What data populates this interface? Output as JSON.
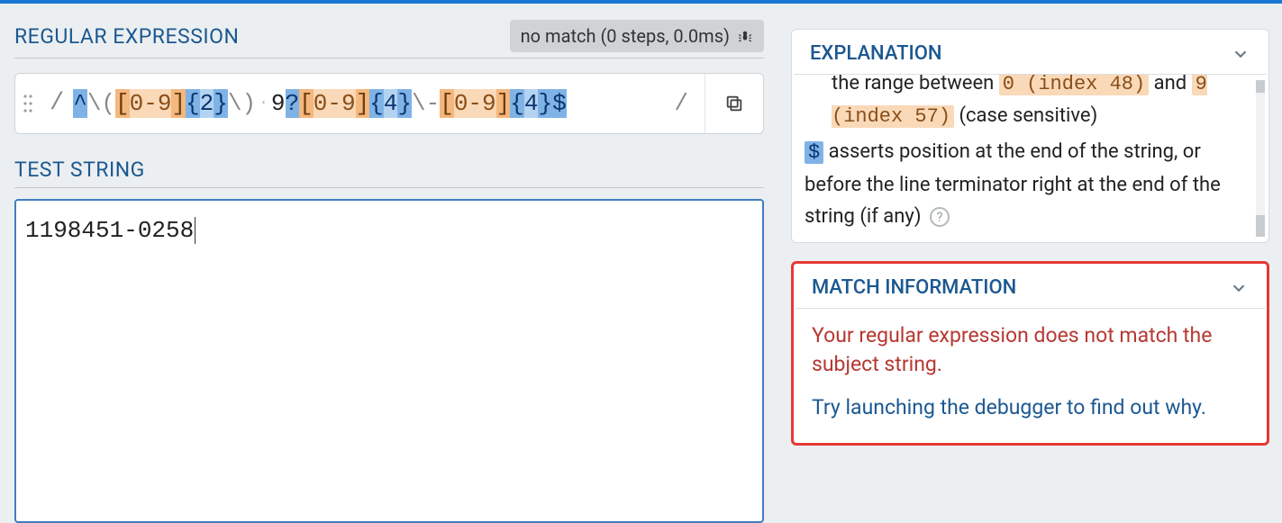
{
  "left": {
    "regex_title": "REGULAR EXPRESSION",
    "status": "no match (0 steps, 0.0ms)",
    "delim_open": "/",
    "delim_close": "/",
    "regex_tokens": [
      {
        "t": "^",
        "c": "tok-anchor"
      },
      {
        "t": "\\(",
        "c": "tok-escape"
      },
      {
        "t": "[",
        "c": "tok-class-bracket"
      },
      {
        "t": "0-9",
        "c": "tok-class-range"
      },
      {
        "t": "]",
        "c": "tok-class-bracket"
      },
      {
        "t": "{",
        "c": "tok-quant-brace"
      },
      {
        "t": "2",
        "c": "tok-quant-num"
      },
      {
        "t": "}",
        "c": "tok-quant-brace"
      },
      {
        "t": "\\)",
        "c": "tok-escape"
      },
      {
        "t": "·",
        "c": "tok-dot"
      },
      {
        "t": "9",
        "c": "tok-literal"
      },
      {
        "t": "?",
        "c": "tok-quant-q"
      },
      {
        "t": "[",
        "c": "tok-class-bracket"
      },
      {
        "t": "0-9",
        "c": "tok-class-range"
      },
      {
        "t": "]",
        "c": "tok-class-bracket"
      },
      {
        "t": "{",
        "c": "tok-quant-brace"
      },
      {
        "t": "4",
        "c": "tok-quant-num"
      },
      {
        "t": "}",
        "c": "tok-quant-brace"
      },
      {
        "t": "\\-",
        "c": "tok-escape"
      },
      {
        "t": "[",
        "c": "tok-class-bracket"
      },
      {
        "t": "0-9",
        "c": "tok-class-range"
      },
      {
        "t": "]",
        "c": "tok-class-bracket"
      },
      {
        "t": "{",
        "c": "tok-quant-brace"
      },
      {
        "t": "4",
        "c": "tok-quant-num"
      },
      {
        "t": "}",
        "c": "tok-quant-brace"
      },
      {
        "t": "$",
        "c": "tok-anchor"
      }
    ],
    "test_title": "TEST STRING",
    "test_value": "1198451-0258"
  },
  "right": {
    "explanation_title": "EXPLANATION",
    "expl_line1_pre": "the range between ",
    "expl_line1_code": "0 (index 48)",
    "expl_line2_pre": " and ",
    "expl_line2_code": "9 (index 57)",
    "expl_line2_post": " (case sensitive)",
    "expl_dollar": "$",
    "expl_dollar_text": " asserts position at the end of the string, or before the line terminator right at the end of the string (if any)",
    "match_title": "MATCH INFORMATION",
    "match_msg": "Your regular expression does not match the subject string.",
    "match_hint": "Try launching the debugger to find out why."
  }
}
